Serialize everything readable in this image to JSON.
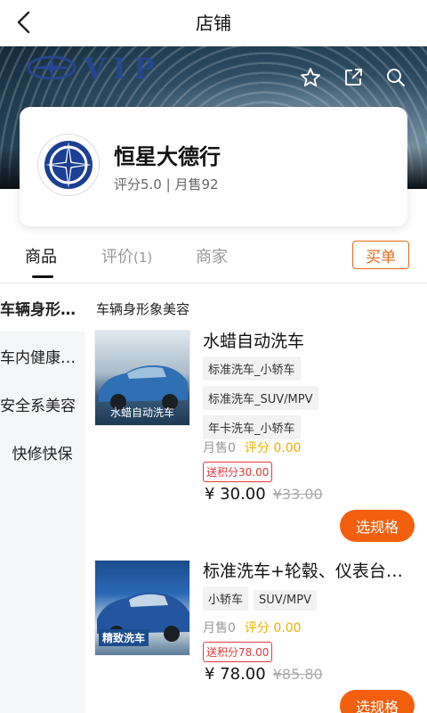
{
  "header": {
    "title": "店铺",
    "back_icon": "chevron-left-icon"
  },
  "banner": {
    "vip_text": "VIP",
    "actions": [
      "star-icon",
      "share-icon",
      "search-icon"
    ]
  },
  "store": {
    "name": "恒星大德行",
    "meta": "评分5.0 | 月售92"
  },
  "tabs": [
    {
      "label": "商品",
      "active": true
    },
    {
      "label": "评价",
      "count": "(1)",
      "active": false
    },
    {
      "label": "商家",
      "active": false
    }
  ],
  "buy_button": "买单",
  "categories": [
    {
      "label": "车辆身形象美容",
      "active": true
    },
    {
      "label": "车内健康环境",
      "active": false
    },
    {
      "label": "安全系美容",
      "active": false
    },
    {
      "label": "快修快保",
      "active": false
    }
  ],
  "section_title": "车辆身形象美容",
  "products": [
    {
      "name": "水蜡自动洗车",
      "thumb_caption": "水蜡自动洗车",
      "tags": [
        "标准洗车_小轿车",
        "标准洗车_SUV/MPV",
        "年卡洗车_小轿车"
      ],
      "sold": "月售0",
      "score": "评分 0.00",
      "points": "送积分30.00",
      "price": "¥ 30.00",
      "original_price": "¥33.00",
      "spec_button": "选规格"
    },
    {
      "name": "标准洗车+轮毂、仪表台保养",
      "thumb_caption": "精致洗车",
      "tags": [
        "小轿车",
        "SUV/MPV"
      ],
      "sold": "月售0",
      "score": "评分 0.00",
      "points": "送积分78.00",
      "price": "¥ 78.00",
      "original_price": "¥85.80",
      "spec_button": "选规格"
    }
  ],
  "colors": {
    "accent": "#f2600f",
    "buy_border": "#e86a1c",
    "score": "#e8b000",
    "points": "#e4393c"
  }
}
